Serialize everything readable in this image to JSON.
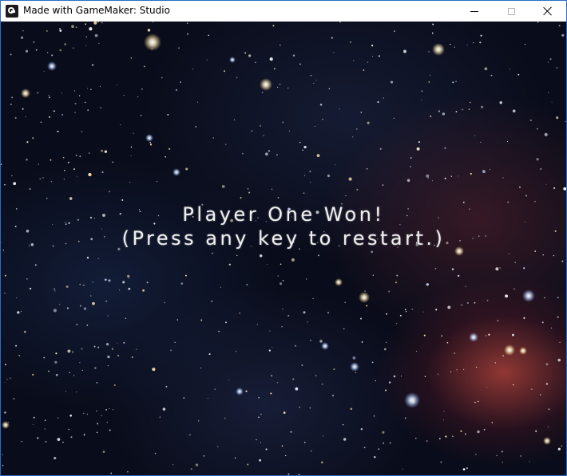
{
  "window": {
    "title": "Made with GameMaker: Studio",
    "icon": "gamemaker-icon",
    "controls": {
      "minimize": "minimize-icon",
      "maximize": "maximize-icon",
      "close": "close-icon"
    }
  },
  "game": {
    "message_line_1": "Player One Won!",
    "message_line_2": "(Press any key to restart.)",
    "background": "starfield-nebula"
  }
}
